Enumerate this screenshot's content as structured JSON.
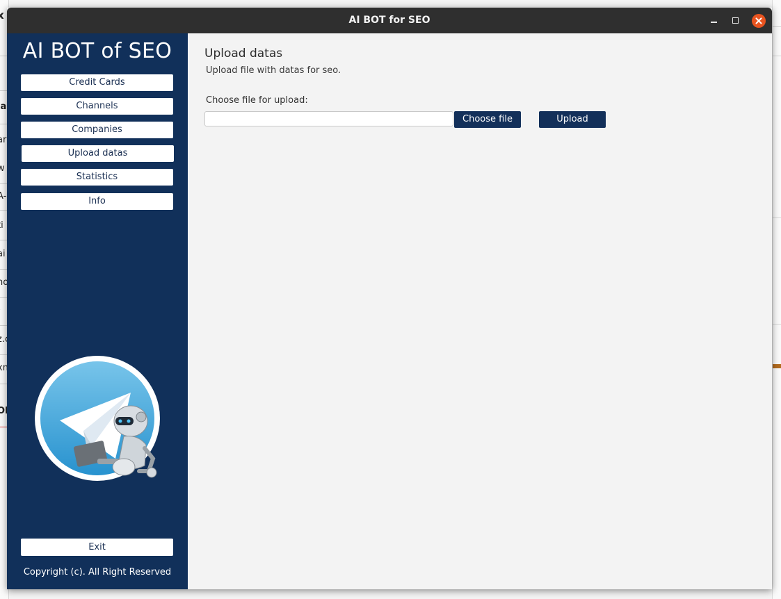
{
  "window": {
    "title": "AI BOT for SEO"
  },
  "sidebar": {
    "brand": "AI BOT of SEO",
    "items": [
      {
        "label": "Credit Cards"
      },
      {
        "label": "Channels"
      },
      {
        "label": "Companies"
      },
      {
        "label": "Upload datas"
      },
      {
        "label": "Statistics"
      },
      {
        "label": "Info"
      }
    ],
    "exit_label": "Exit",
    "copyright": "Copyright (c). All Right Reserved",
    "logo_icon": "telegram-robot-logo"
  },
  "main": {
    "title": "Upload datas",
    "subtitle": "Upload file with datas for seo.",
    "file_label": "Choose file for upload:",
    "file_value": "",
    "choose_label": "Choose file",
    "upload_label": "Upload"
  },
  "background": {
    "left_fragments": [
      "x",
      "la",
      "ar",
      "w",
      "A-I",
      "ti",
      "ai",
      "no",
      "-",
      "z.c",
      "xn",
      "OM"
    ]
  },
  "colors": {
    "sidebar_bg": "#11305a",
    "button_dark": "#13305a",
    "titlebar": "#2f2f2f",
    "close_button": "#e95420"
  }
}
